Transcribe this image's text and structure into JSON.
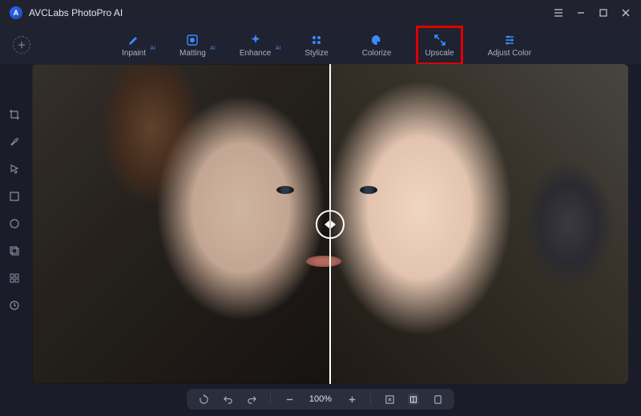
{
  "app": {
    "title": "AVCLabs PhotoPro AI"
  },
  "tools": {
    "inpaint": "Inpaint",
    "matting": "Matting",
    "enhance": "Enhance",
    "stylize": "Stylize",
    "colorize": "Colorize",
    "upscale": "Upscale",
    "adjust": "Adjust Color",
    "ai_badge": "AI"
  },
  "zoom": {
    "level": "100%"
  }
}
